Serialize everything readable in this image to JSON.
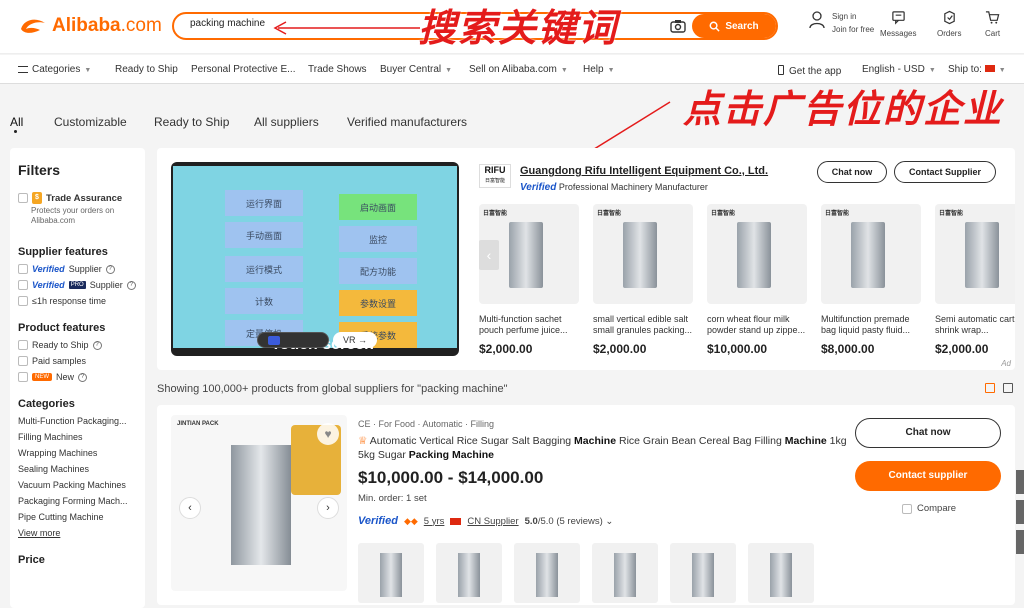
{
  "header": {
    "logo_text": "Alibaba",
    "logo_com": ".com",
    "search_value": "packing machine",
    "search_button": "Search",
    "annotation_search": "搜索关键词",
    "sign_in": "Sign in",
    "join_free": "Join for free",
    "messages": "Messages",
    "orders": "Orders",
    "cart": "Cart"
  },
  "nav": {
    "categories": "Categories",
    "ready_to_ship": "Ready to Ship",
    "ppe": "Personal Protective E...",
    "trade_shows": "Trade Shows",
    "buyer_central": "Buyer Central",
    "sell": "Sell on Alibaba.com",
    "help": "Help",
    "get_app": "Get the app",
    "language": "English - USD",
    "ship_to": "Ship to:"
  },
  "tabs": [
    "All",
    "Customizable",
    "Ready to Ship",
    "All suppliers",
    "Verified manufacturers"
  ],
  "annotation_ad": "点击广告位的企业",
  "filters": {
    "title": "Filters",
    "trade_assurance": "Trade Assurance",
    "trade_assurance_desc": "Protects your orders on Alibaba.com",
    "supplier_features": "Supplier features",
    "verified": "Verified",
    "supplier": "Supplier",
    "pro": "PRO",
    "response_time": "≤1h response time",
    "product_features": "Product features",
    "ready_to_ship": "Ready to Ship",
    "paid_samples": "Paid samples",
    "new_tag": "NEW",
    "new": "New",
    "categories_title": "Categories",
    "categories": [
      "Multi-Function Packaging...",
      "Filling Machines",
      "Wrapping Machines",
      "Sealing Machines",
      "Vacuum Packing Machines",
      "Packaging Forming Mach...",
      "Pipe Cutting Machine"
    ],
    "view_more": "View more",
    "price": "Price"
  },
  "ad": {
    "screen_buttons": [
      "运行界面",
      "启动画面",
      "手动画面",
      "监控",
      "运行模式",
      "配方功能",
      "计数",
      "参数设置",
      "定量停机",
      "系统参数"
    ],
    "touch_label": "Touch screen",
    "vr": "VR",
    "supplier_logo": "RIFU",
    "supplier_logo_sub": "日富智能",
    "supplier_name": "Guangdong Rifu Intelligent Equipment Co., Ltd.",
    "verified": "Verified",
    "verified_desc": "Professional Machinery Manufacturer",
    "chat_now": "Chat now",
    "contact_supplier": "Contact Supplier",
    "ad_tag": "Ad",
    "products": [
      {
        "title": "Multi-function sachet pouch perfume juice...",
        "price": "$2,000.00"
      },
      {
        "title": "small vertical edible salt small granules packing...",
        "price": "$2,000.00"
      },
      {
        "title": "corn wheat flour milk powder stand up zippe...",
        "price": "$10,000.00"
      },
      {
        "title": "Multifunction premade bag liquid pasty fluid...",
        "price": "$8,000.00"
      },
      {
        "title": "Semi automatic cart heat shrink wrap...",
        "price": "$2,000.00"
      }
    ]
  },
  "results": {
    "summary": "Showing 100,000+ products from global suppliers for \"packing machine\""
  },
  "listing": {
    "brand": "JINTIAN PACK",
    "tags": "CE · For Food · Automatic · Filling",
    "title_html_parts": [
      "Automatic Vertical Rice Sugar Salt Bagging ",
      "Machine",
      " Rice Grain Bean Cereal Bag Filling ",
      "Machine",
      " 1kg 5kg Sugar ",
      "Packing Machine"
    ],
    "price": "$10,000.00 - $14,000.00",
    "moq": "Min. order: 1 set",
    "verified": "Verified",
    "years": "5 yrs",
    "country": "CN Supplier",
    "rating": "5.0",
    "rating_of": "/5.0 (5 reviews)",
    "chat_now": "Chat now",
    "contact_supplier": "Contact supplier",
    "compare": "Compare"
  }
}
